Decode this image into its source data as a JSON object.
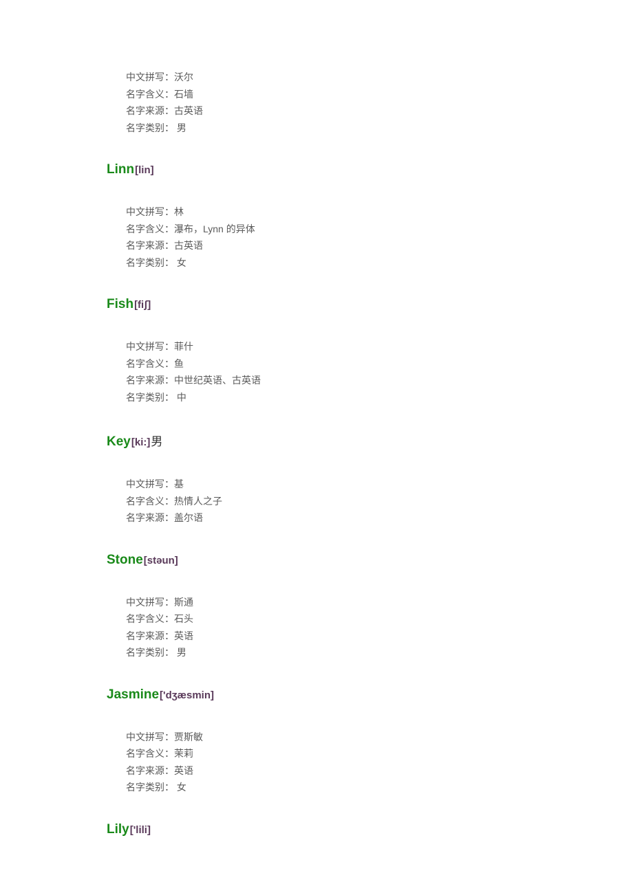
{
  "labels": {
    "pinyin": "中文拼写：",
    "meaning": "名字含义：",
    "origin": "名字来源：",
    "gender": "名字类别： "
  },
  "entries": [
    {
      "name": "",
      "pron": "",
      "suffix": "",
      "showHeading": false,
      "details": {
        "pinyin": "沃尔",
        "meaning": "石墙",
        "origin": "古英语",
        "gender": "男"
      }
    },
    {
      "name": "Linn",
      "pron": "[lin]",
      "suffix": "",
      "showHeading": true,
      "details": {
        "pinyin": "林",
        "meaning": "瀑布，Lynn 的异体",
        "origin": "古英语",
        "gender": "女"
      }
    },
    {
      "name": "Fish",
      "pron": "[fiʃ]",
      "suffix": "",
      "showHeading": true,
      "details": {
        "pinyin": "菲什",
        "meaning": "鱼",
        "origin": "中世纪英语、古英语",
        "gender": "中"
      }
    },
    {
      "name": "Key",
      "pron": "[ki:]",
      "suffix": "男",
      "showHeading": true,
      "details": {
        "pinyin": "基",
        "meaning": "热情人之子",
        "origin": "盖尔语",
        "gender": null
      }
    },
    {
      "name": "Stone",
      "pron": "[stəun]",
      "suffix": "",
      "showHeading": true,
      "details": {
        "pinyin": "斯通",
        "meaning": "石头",
        "origin": "英语",
        "gender": "男"
      }
    },
    {
      "name": "Jasmine",
      "pron": "['dʒæsmin]",
      "suffix": "",
      "showHeading": true,
      "details": {
        "pinyin": "贾斯敏",
        "meaning": "茉莉",
        "origin": "英语",
        "gender": "女"
      }
    },
    {
      "name": "Lily",
      "pron": "['lili]",
      "suffix": "",
      "showHeading": true,
      "details": null
    }
  ]
}
